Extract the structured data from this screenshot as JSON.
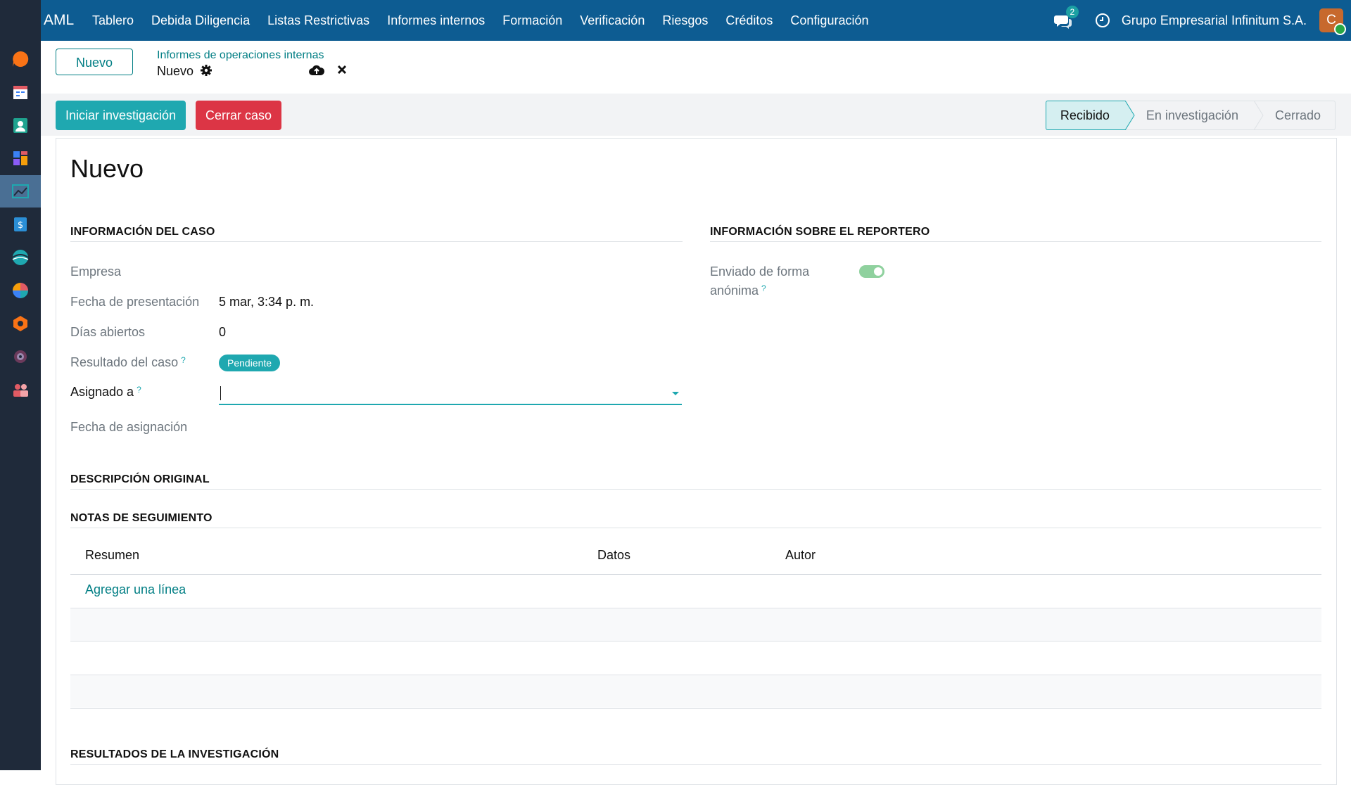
{
  "topbar": {
    "brand": "AML",
    "menu": [
      "Tablero",
      "Debida Diligencia",
      "Listas Restrictivas",
      "Informes internos",
      "Formación",
      "Verificación",
      "Riesgos",
      "Créditos",
      "Configuración"
    ],
    "chat_count": "2",
    "company": "Grupo Empresarial Infinitum S.A.",
    "avatar_initial": "C"
  },
  "rail": {
    "icons": [
      "discuss-icon",
      "calendar-icon",
      "contacts-icon",
      "dashboard-icon",
      "aml-reports-icon",
      "invoicing-icon",
      "website-icon",
      "analytics-icon",
      "inventory-icon",
      "settings-icon",
      "employees-icon"
    ],
    "active_index": 4
  },
  "control_panel": {
    "new_button": "Nuevo",
    "breadcrumb_parent": "Informes de operaciones internas",
    "breadcrumb_current": "Nuevo"
  },
  "statusbar": {
    "start_button": "Iniciar investigación",
    "close_button": "Cerrar caso",
    "stages": [
      "Recibido",
      "En investigación",
      "Cerrado"
    ],
    "active_stage": "Recibido"
  },
  "form": {
    "title": "Nuevo",
    "case_info": {
      "heading": "INFORMACIÓN DEL CASO",
      "company_label": "Empresa",
      "company_value": "",
      "submission_date_label": "Fecha de presentación",
      "submission_date_value": "5 mar, 3:34 p. m.",
      "days_open_label": "Días abiertos",
      "days_open_value": "0",
      "result_label": "Resultado del caso",
      "result_value": "Pendiente",
      "assigned_label": "Asignado a",
      "assigned_value": "",
      "assignment_date_label": "Fecha de asignación",
      "help_mark": "?"
    },
    "reporter_info": {
      "heading": "INFORMACIÓN SOBRE EL REPORTERO",
      "anonymous_label_1": "Enviado de forma",
      "anonymous_label_2": "anónima",
      "anonymous_value": true
    },
    "original_description_heading": "DESCRIPCIÓN ORIGINAL",
    "followup": {
      "heading": "NOTAS DE SEGUIMIENTO",
      "columns": [
        "Resumen",
        "Datos",
        "Autor"
      ],
      "add_line": "Agregar una línea"
    },
    "results_heading": "RESULTADOS DE LA INVESTIGACIÓN"
  },
  "colors": {
    "topbar": "#0d5c92",
    "accent": "#1fa8b0",
    "danger": "#dc3545",
    "rail": "#1f2a3a"
  }
}
